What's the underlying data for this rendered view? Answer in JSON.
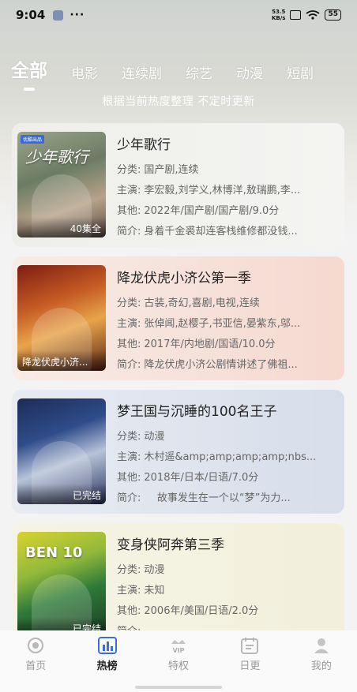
{
  "status_bar": {
    "time": "9:04",
    "dots": "···",
    "speed_value": "53.5",
    "speed_unit": "KB/s",
    "battery": "55"
  },
  "tabs": [
    {
      "label": "全部",
      "active": true
    },
    {
      "label": "电影",
      "active": false
    },
    {
      "label": "连续剧",
      "active": false
    },
    {
      "label": "综艺",
      "active": false
    },
    {
      "label": "动漫",
      "active": false
    },
    {
      "label": "短剧",
      "active": false
    }
  ],
  "subtitle": "根据当前热度整理 不定时更新",
  "labels": {
    "category": "分类:",
    "cast": "主演:",
    "other": "其他:",
    "intro": "简介:"
  },
  "items": [
    {
      "title": "少年歌行",
      "category": "国产剧,连续",
      "cast": "李宏毅,刘学义,林博洋,敖瑞鹏,李...",
      "other": "2022年/国产剧/国产剧/9.0分",
      "intro": "身着千金裘却连客栈维修都没钱...",
      "poster_caption": "40集全",
      "poster_mark": "少年歌行",
      "poster_badge": "优酷出品"
    },
    {
      "title": "降龙伏虎小济公第一季",
      "category": "古装,奇幻,喜剧,电视,连续",
      "cast": "张倬闻,赵樱子,书亚信,晏紫东,邬...",
      "other": "2017年/内地剧/国语/10.0分",
      "intro": "降龙伏虎小济公剧情讲述了佛祖...",
      "poster_caption": "降龙伏虎小济..."
    },
    {
      "title": "梦王国与沉睡的100名王子",
      "category": "动漫",
      "cast": "木村遥&amp;amp;amp;amp;nbs...",
      "other": "2018年/日本/日语/7.0分",
      "intro": "    故事发生在一个以“梦”为力...",
      "poster_caption": "已完结"
    },
    {
      "title": "变身侠阿奔第三季",
      "category": "动漫",
      "cast": "未知",
      "other": "2006年/美国/日语/2.0分",
      "intro": "",
      "poster_caption": "已完结",
      "poster_mark": "BEN 10"
    }
  ],
  "bottom_nav": [
    {
      "label": "首页",
      "icon": "home-icon",
      "active": false
    },
    {
      "label": "热榜",
      "icon": "chart-icon",
      "active": true
    },
    {
      "label": "特权",
      "icon": "vip-crown-icon",
      "icon_text": "VIP",
      "active": false
    },
    {
      "label": "日更",
      "icon": "calendar-icon",
      "active": false
    },
    {
      "label": "我的",
      "icon": "profile-icon",
      "active": false
    }
  ],
  "colors": {
    "accent": "#3b6fd8",
    "active_nav": "#222222",
    "inactive_nav": "#9a9a9a"
  }
}
